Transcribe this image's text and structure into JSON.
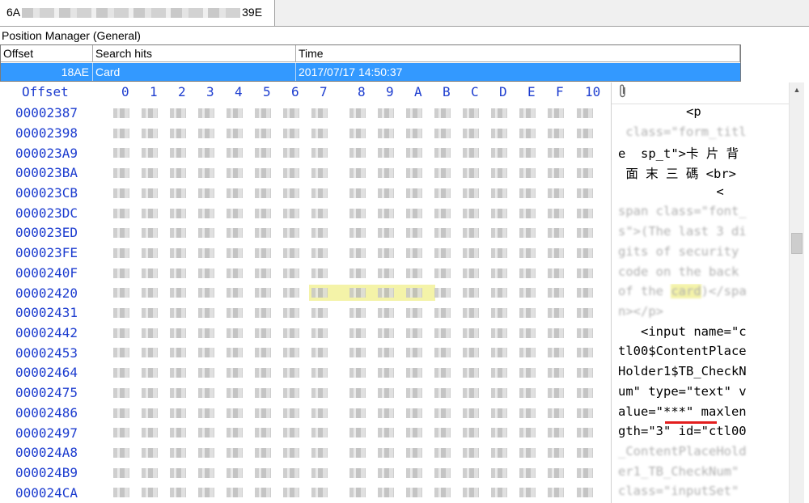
{
  "tab": {
    "title_prefix": "6A",
    "title_suffix": "39E"
  },
  "position_manager": {
    "title": "Position Manager (General)",
    "columns": [
      "Offset",
      "Search hits",
      "Time"
    ],
    "rows": [
      {
        "offset": "18AE",
        "hit": "Card",
        "time": "2017/07/17  14:50:37"
      }
    ]
  },
  "hex_view": {
    "offset_header": "Offset",
    "columns": [
      "0",
      "1",
      "2",
      "3",
      "4",
      "5",
      "6",
      "7",
      "8",
      "9",
      "A",
      "B",
      "C",
      "D",
      "E",
      "F",
      "10"
    ],
    "offsets": [
      "00002387",
      "00002398",
      "000023A9",
      "000023BA",
      "000023CB",
      "000023DC",
      "000023ED",
      "000023FE",
      "0000240F",
      "00002420",
      "00002431",
      "00002442",
      "00002453",
      "00002464",
      "00002475",
      "00002486",
      "00002497",
      "000024A8",
      "000024B9",
      "000024CA"
    ],
    "highlight_color": "#f4f3a8"
  },
  "ascii_panel": {
    "header_icon": "paperclip-icon",
    "lines": [
      {
        "t": "         <p"
      },
      {
        "t": " class=\"form_titl"
      },
      {
        "t": "e  sp_t\">卡 片 背"
      },
      {
        "t": " 面 末 三 碼 <br>"
      },
      {
        "t": "             <"
      },
      {
        "t": "span class=\"font_"
      },
      {
        "t": "s\">(The last 3 di"
      },
      {
        "t": "gits of security"
      },
      {
        "t": "code on the back"
      },
      {
        "pre": "of the ",
        "mark": "card",
        "post": ")</spa"
      },
      {
        "t": "n></p>"
      },
      {
        "t": "   <input name=\"c"
      },
      {
        "t": "tl00$ContentPlace"
      },
      {
        "t": "Holder1$TB_CheckN"
      },
      {
        "t": "um\" type=\"text\" v"
      },
      {
        "t": "alue=\"***\" maxlen"
      },
      {
        "t": "gth=\"3\" id=\"ctl00"
      },
      {
        "t": "_ContentPlaceHold"
      },
      {
        "t": "er1_TB_CheckNum\""
      },
      {
        "t": "class=\"inputSet\""
      }
    ]
  }
}
